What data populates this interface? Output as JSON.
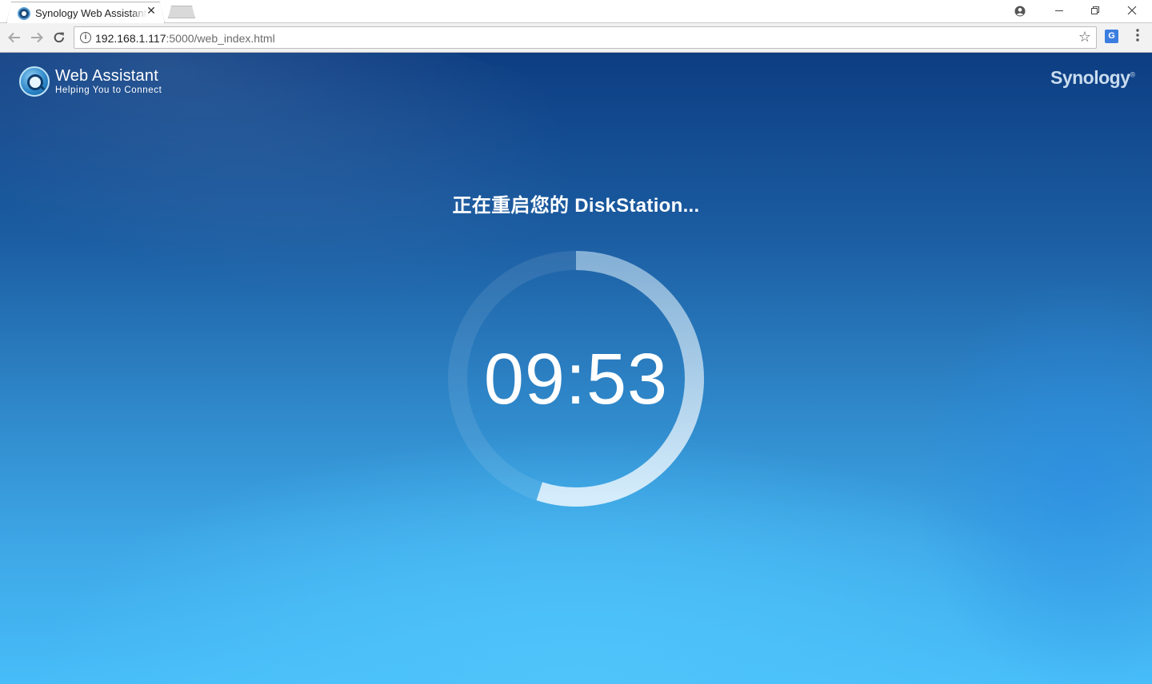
{
  "browser": {
    "tab_title": "Synology Web Assistant",
    "tab_close_icon": "close-icon",
    "window_controls": {
      "profile_icon": "account-icon",
      "minimize_icon": "minimize-icon",
      "restore_icon": "restore-icon",
      "close_icon": "close-icon"
    },
    "nav": {
      "back_icon": "arrow-left-icon",
      "forward_icon": "arrow-right-icon",
      "reload_icon": "reload-icon"
    },
    "url_host": "192.168.1.117",
    "url_rest": ":5000/web_index.html",
    "bookmark_icon": "star-icon",
    "translate_icon": "translate-icon",
    "menu_icon": "more-vert-icon"
  },
  "header": {
    "app_title": "Web Assistant",
    "app_subtitle": "Helping You to Connect",
    "vendor_logo": "Synology"
  },
  "main": {
    "status_title": "正在重启您的 DiskStation...",
    "countdown": "09:53",
    "progress_fraction": 0.55
  },
  "colors": {
    "background_top": "#0d3d82",
    "background_bottom": "#47bdf8",
    "ring_track": "rgba(255,255,255,0.10)",
    "ring_progress": "#c8e4f7"
  }
}
